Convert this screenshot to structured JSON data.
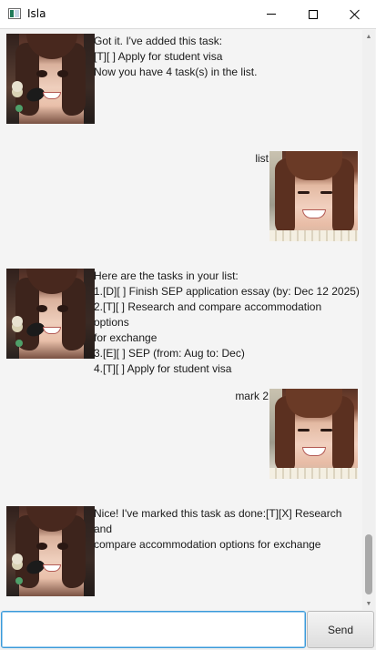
{
  "window": {
    "title": "Isla",
    "controls": {
      "minimize": "minimize-icon",
      "maximize": "maximize-icon",
      "close": "close-icon"
    }
  },
  "chat": {
    "messages": [
      {
        "sender": "bot",
        "text": "Got it. I've added this task:\n[T][ ] Apply for student visa\nNow you have 4 task(s) in the list."
      },
      {
        "sender": "user",
        "text": "list"
      },
      {
        "sender": "bot",
        "text": "Here are the tasks in your list:\n1.[D][ ] Finish SEP application essay (by: Dec 12 2025)\n2.[T][ ] Research and compare accommodation options\nfor exchange\n3.[E][ ] SEP (from: Aug to: Dec)\n4.[T][ ] Apply for student visa"
      },
      {
        "sender": "user",
        "text": "mark 2"
      },
      {
        "sender": "bot",
        "text": "Nice! I've marked this task as done:[T][X] Research and\ncompare accommodation options for exchange"
      }
    ]
  },
  "input": {
    "value": "",
    "placeholder": ""
  },
  "send_button": {
    "label": "Send"
  },
  "colors": {
    "chat_background": "#f4f4f4",
    "input_focus_border": "#3b9ad9",
    "window_background": "#ffffff"
  }
}
